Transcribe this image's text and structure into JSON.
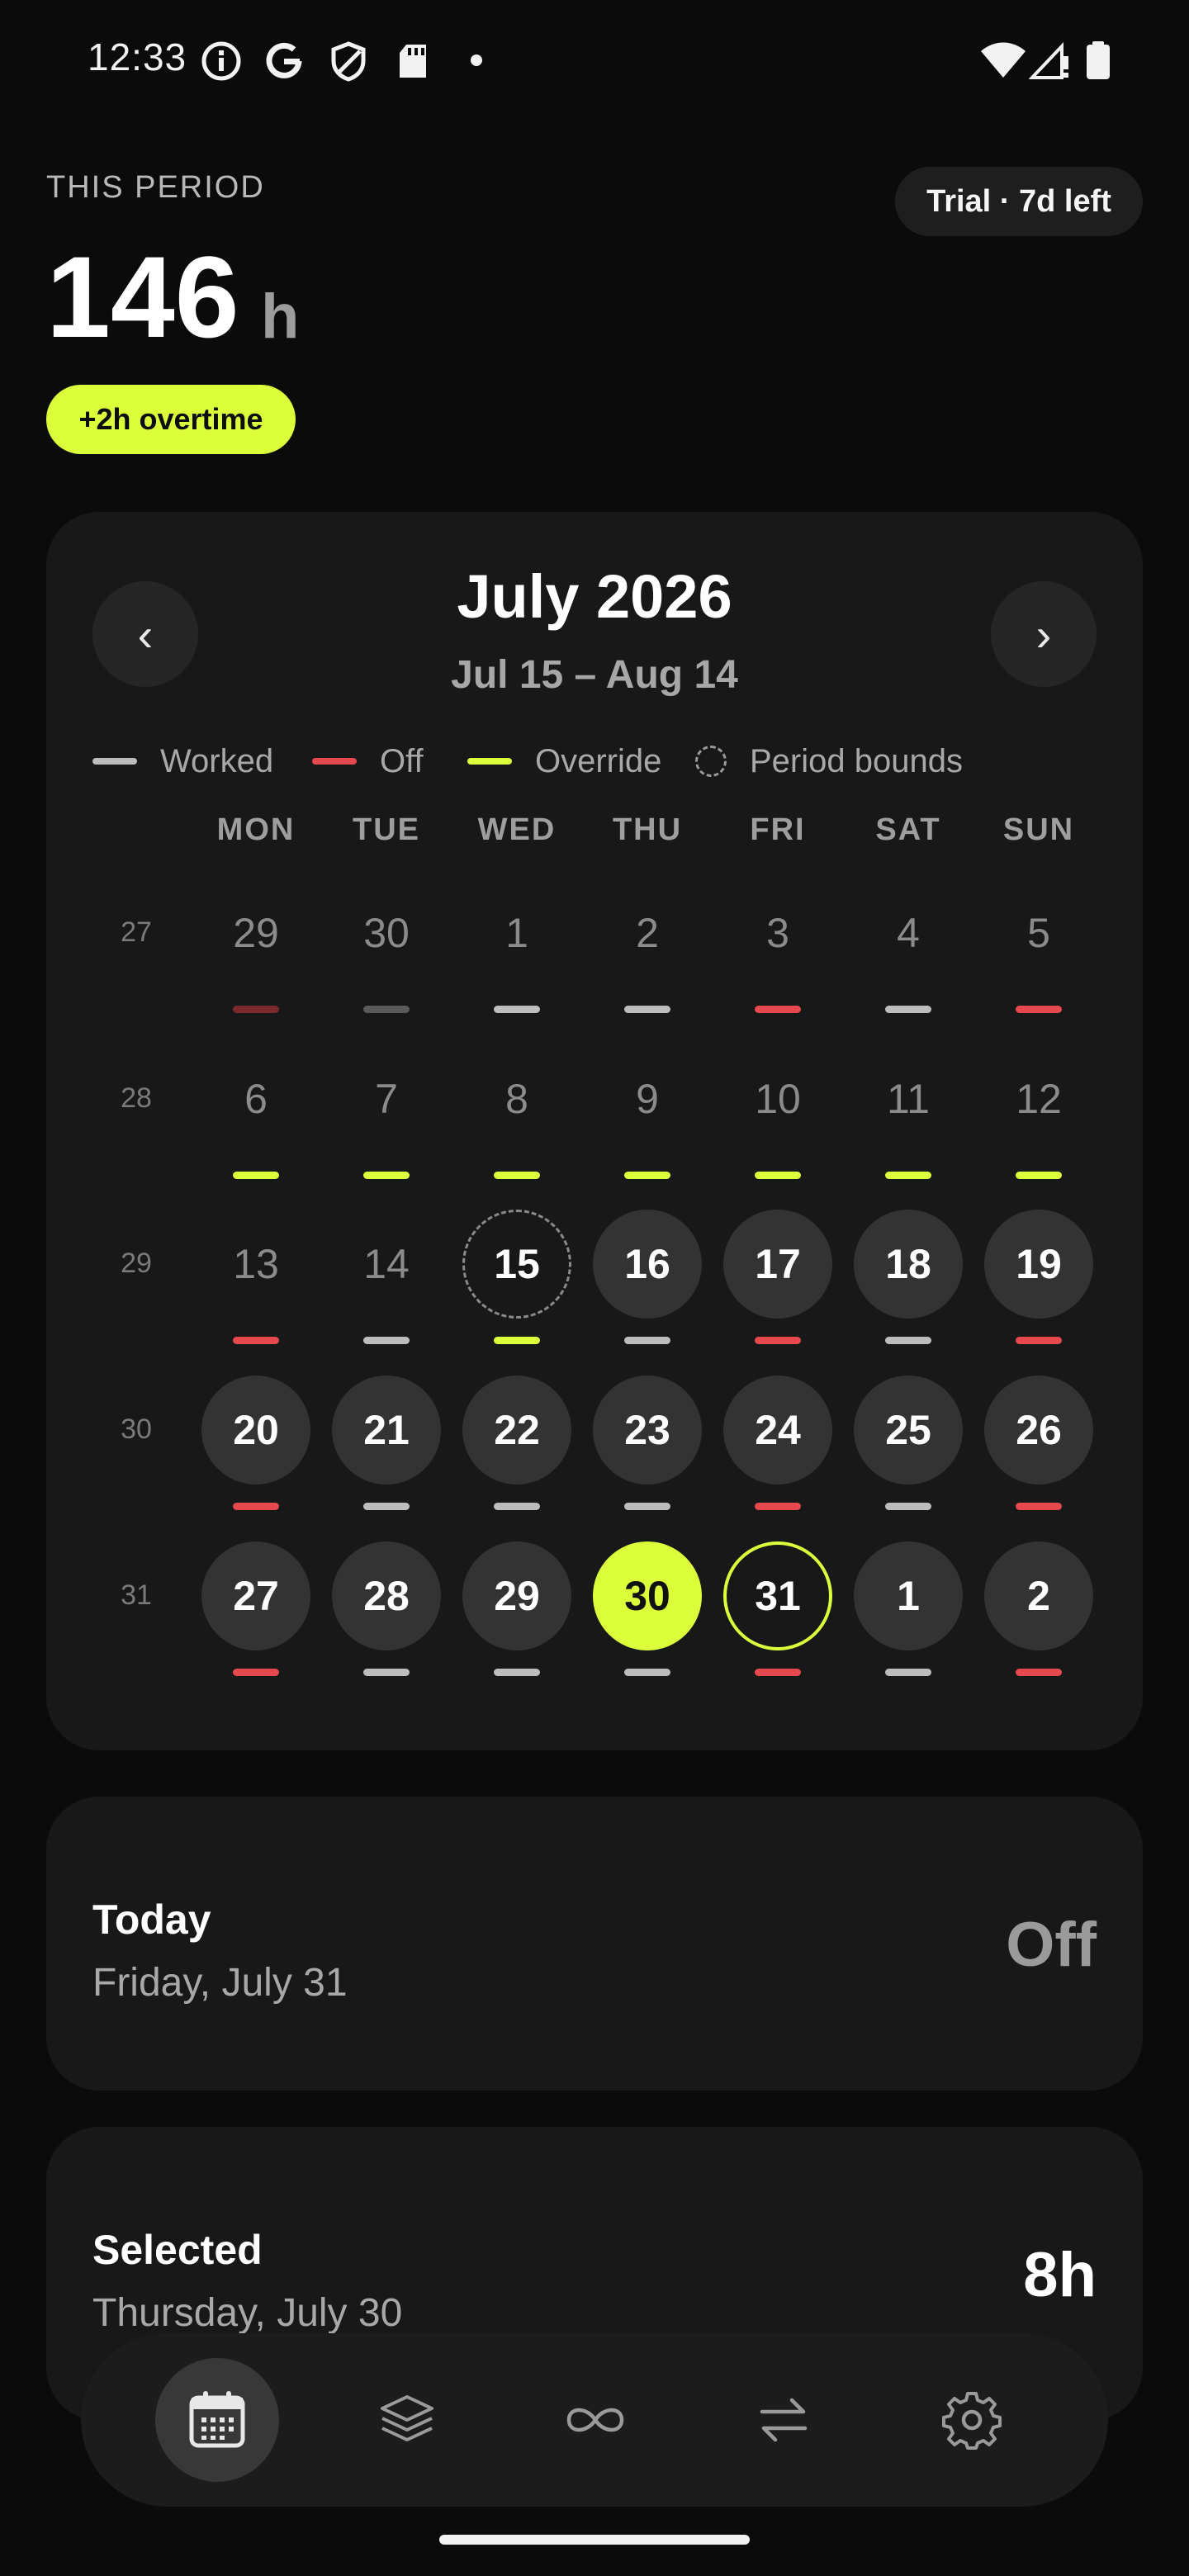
{
  "status_bar": {
    "time": "12:33",
    "left_icons": [
      "info-circle-icon",
      "google-g-icon",
      "shield-icon",
      "sd-card-icon",
      "notification-dot-icon"
    ],
    "right_icons": [
      "wifi-icon",
      "cell-signal-icon",
      "battery-icon"
    ]
  },
  "header": {
    "period_label": "THIS PERIOD",
    "hours_value": "146",
    "hours_unit": "h",
    "overtime_badge": "+2h overtime",
    "trial_badge": "Trial · 7d left"
  },
  "calendar": {
    "prev_label": "‹",
    "next_label": "›",
    "month_title": "July 2026",
    "range_subtitle": "Jul 15 – Aug 14",
    "legend": [
      {
        "label": "Worked",
        "color": "#bdbdbd"
      },
      {
        "label": "Off",
        "color": "#e5484d"
      },
      {
        "label": "Override",
        "color": "#dbff3a"
      },
      {
        "label": "Period bounds",
        "color": "#9a9a9a"
      }
    ],
    "weekdays": [
      "MON",
      "TUE",
      "WED",
      "THU",
      "FRI",
      "SAT",
      "SUN"
    ],
    "colors": {
      "worked": "#bdbdbd",
      "off": "#e5484d",
      "override": "#dbff3a",
      "worked_dim": "#5a5a5a",
      "off_dim": "#7a2a2c"
    },
    "weeks": [
      {
        "number": "27",
        "days": [
          {
            "label": "29",
            "state": "outside",
            "mark": "off_dim"
          },
          {
            "label": "30",
            "state": "outside",
            "mark": "worked_dim"
          },
          {
            "label": "1",
            "state": "past",
            "mark": "worked"
          },
          {
            "label": "2",
            "state": "past",
            "mark": "worked"
          },
          {
            "label": "3",
            "state": "past",
            "mark": "off"
          },
          {
            "label": "4",
            "state": "past",
            "mark": "worked"
          },
          {
            "label": "5",
            "state": "past",
            "mark": "off"
          }
        ]
      },
      {
        "number": "28",
        "days": [
          {
            "label": "6",
            "state": "past",
            "mark": "override"
          },
          {
            "label": "7",
            "state": "past",
            "mark": "override"
          },
          {
            "label": "8",
            "state": "past",
            "mark": "override"
          },
          {
            "label": "9",
            "state": "past",
            "mark": "override"
          },
          {
            "label": "10",
            "state": "past",
            "mark": "override"
          },
          {
            "label": "11",
            "state": "past",
            "mark": "override"
          },
          {
            "label": "12",
            "state": "past",
            "mark": "override"
          }
        ]
      },
      {
        "number": "29",
        "days": [
          {
            "label": "13",
            "state": "past",
            "mark": "off"
          },
          {
            "label": "14",
            "state": "past",
            "mark": "worked"
          },
          {
            "label": "15",
            "state": "start",
            "mark": "override"
          },
          {
            "label": "16",
            "state": "inperiod",
            "mark": "worked"
          },
          {
            "label": "17",
            "state": "inperiod",
            "mark": "off"
          },
          {
            "label": "18",
            "state": "inperiod",
            "mark": "worked"
          },
          {
            "label": "19",
            "state": "inperiod",
            "mark": "off"
          }
        ]
      },
      {
        "number": "30",
        "days": [
          {
            "label": "20",
            "state": "inperiod",
            "mark": "off"
          },
          {
            "label": "21",
            "state": "inperiod",
            "mark": "worked"
          },
          {
            "label": "22",
            "state": "inperiod",
            "mark": "worked"
          },
          {
            "label": "23",
            "state": "inperiod",
            "mark": "worked"
          },
          {
            "label": "24",
            "state": "inperiod",
            "mark": "off"
          },
          {
            "label": "25",
            "state": "inperiod",
            "mark": "worked"
          },
          {
            "label": "26",
            "state": "inperiod",
            "mark": "off"
          }
        ]
      },
      {
        "number": "31",
        "days": [
          {
            "label": "27",
            "state": "inperiod",
            "mark": "off"
          },
          {
            "label": "28",
            "state": "inperiod",
            "mark": "worked"
          },
          {
            "label": "29",
            "state": "inperiod",
            "mark": "worked"
          },
          {
            "label": "30",
            "state": "selected",
            "mark": "worked"
          },
          {
            "label": "31",
            "state": "today",
            "mark": "off"
          },
          {
            "label": "1",
            "state": "inperiod",
            "mark": "worked"
          },
          {
            "label": "2",
            "state": "inperiod",
            "mark": "off"
          }
        ]
      }
    ]
  },
  "today_card": {
    "title": "Today",
    "date": "Friday, July 31",
    "value": "Off",
    "value_color": "#9a9a9a"
  },
  "selected_card": {
    "title": "Selected",
    "date": "Thursday, July 30",
    "value": "8h",
    "value_color": "#ffffff"
  },
  "bottom_nav": {
    "items": [
      {
        "name": "calendar-icon",
        "active": true
      },
      {
        "name": "layers-icon",
        "active": false
      },
      {
        "name": "infinity-icon",
        "active": false
      },
      {
        "name": "swap-arrows-icon",
        "active": false
      },
      {
        "name": "gear-icon",
        "active": false
      }
    ]
  }
}
